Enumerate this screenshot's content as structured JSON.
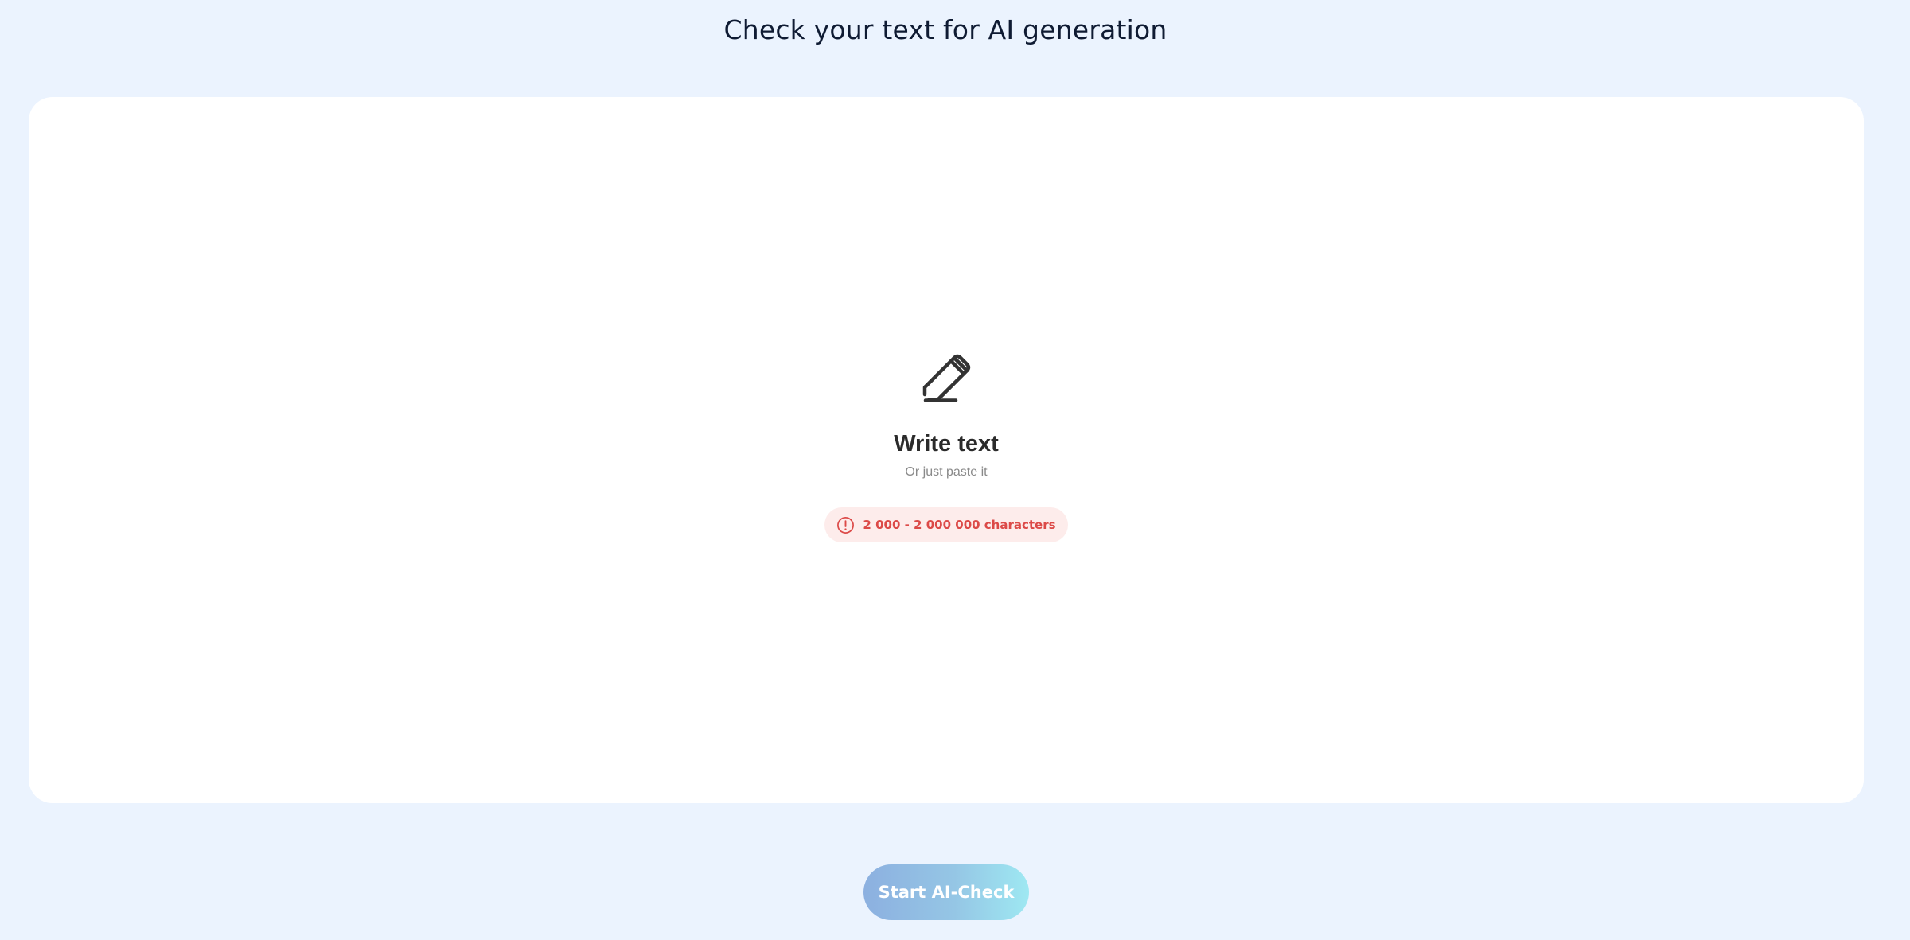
{
  "header": {
    "title": "Check your text for AI generation"
  },
  "editor": {
    "icon": "pencil-icon",
    "title": "Write text",
    "subtitle": "Or just paste it",
    "limit_badge": {
      "icon": "alert-circle-icon",
      "text": "2 000 - 2 000 000 characters"
    }
  },
  "actions": {
    "start_label": "Start AI-Check"
  },
  "colors": {
    "background": "#ebf3fe",
    "card": "#ffffff",
    "badge_background": "#fdeceb",
    "badge_text": "#dc4a48",
    "button_gradient_start": "#8cb0e0",
    "button_gradient_end": "#9ee8f2"
  }
}
